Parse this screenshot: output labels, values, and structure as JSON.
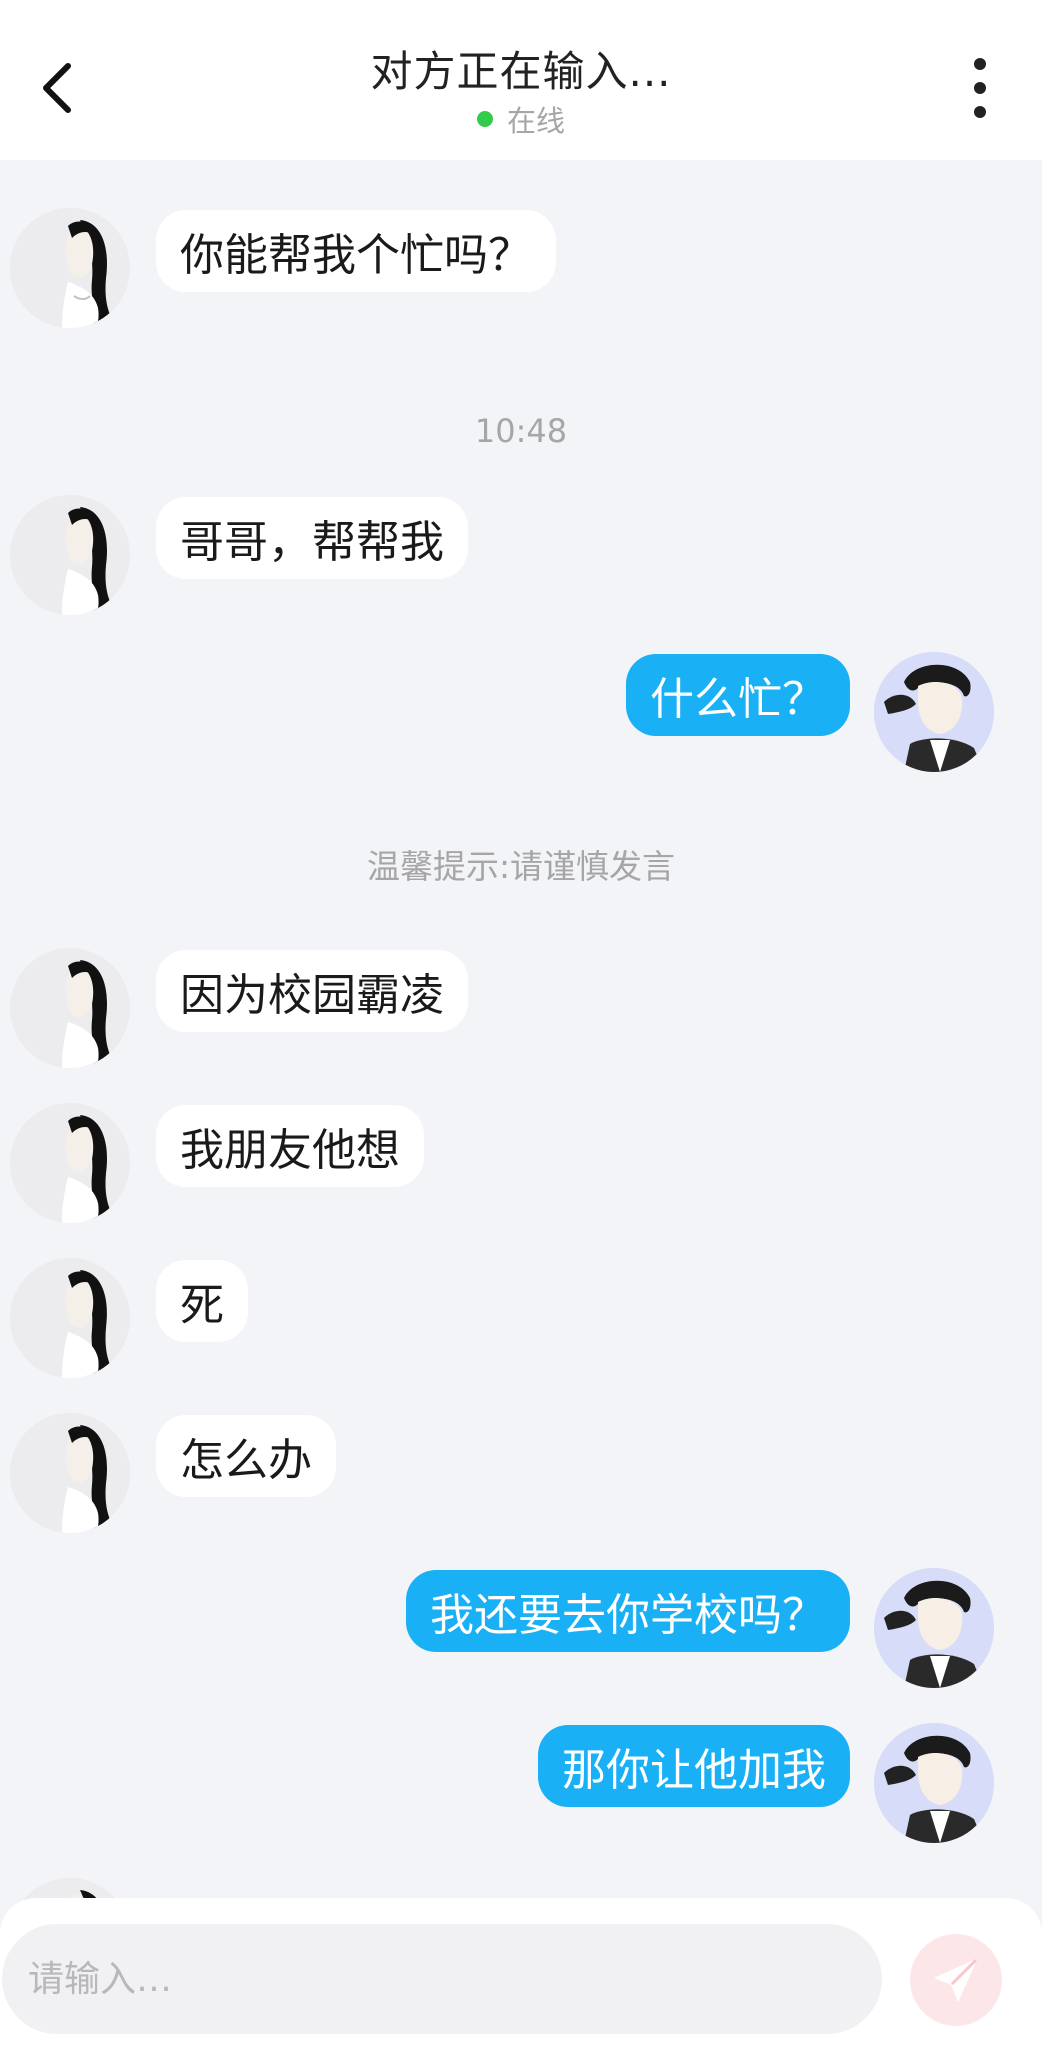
{
  "header": {
    "title": "对方正在输入...",
    "status": "在线",
    "status_color": "#33cc4a"
  },
  "messages": [
    {
      "side": "left",
      "text": "你能帮我个忙吗？"
    },
    {
      "type": "timestamp",
      "text": "10:48"
    },
    {
      "side": "left",
      "text": "哥哥，帮帮我"
    },
    {
      "side": "right",
      "text": "什么忙？"
    },
    {
      "type": "notice",
      "text": "温馨提示:请谨慎发言"
    },
    {
      "side": "left",
      "text": "因为校园霸凌"
    },
    {
      "side": "left",
      "text": "我朋友他想"
    },
    {
      "side": "left",
      "text": "死"
    },
    {
      "side": "left",
      "text": "怎么办"
    },
    {
      "side": "right",
      "text": "我还要去你学校吗？"
    },
    {
      "side": "right",
      "text": "那你让他加我"
    }
  ],
  "input": {
    "placeholder": "请输入…"
  },
  "colors": {
    "sent_bubble": "#1ab0f5",
    "received_bubble": "#ffffff",
    "background": "#f3f4f8"
  },
  "icons": {
    "back": "chevron-left-icon",
    "more": "more-vertical-icon",
    "send": "paper-plane-icon"
  }
}
